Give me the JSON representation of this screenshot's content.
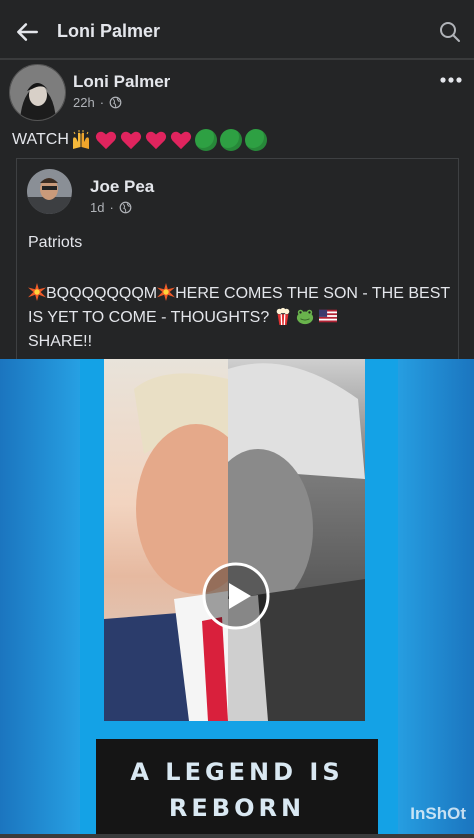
{
  "header": {
    "title": "Loni Palmer"
  },
  "post": {
    "author": "Loni Palmer",
    "time": "22h",
    "separator": "·",
    "text": "WATCH"
  },
  "shared": {
    "author": "Joe Pea",
    "time": "1d",
    "separator": "·",
    "line1": "Patriots",
    "line2_part1": "BQQQQQQQM",
    "line2_part2": "HERE COMES THE SON - THE BEST IS YET TO COME - THOUGHTS?",
    "line2_part3": "SHARE!!"
  },
  "video": {
    "banner_line1": "A LEGEND IS",
    "banner_line2": "REBORN",
    "watermark": "InShOt"
  },
  "icons": {
    "back": "arrow-left-icon",
    "search": "search-icon",
    "more": "more-dots-icon",
    "globe": "globe-icon",
    "play": "play-icon"
  },
  "colors": {
    "background": "#242526",
    "text": "#e4e6eb",
    "muted": "#b0b3b8",
    "heart": "#e0245e",
    "green": "#2ea043",
    "video_blue": "#14a2e6"
  }
}
